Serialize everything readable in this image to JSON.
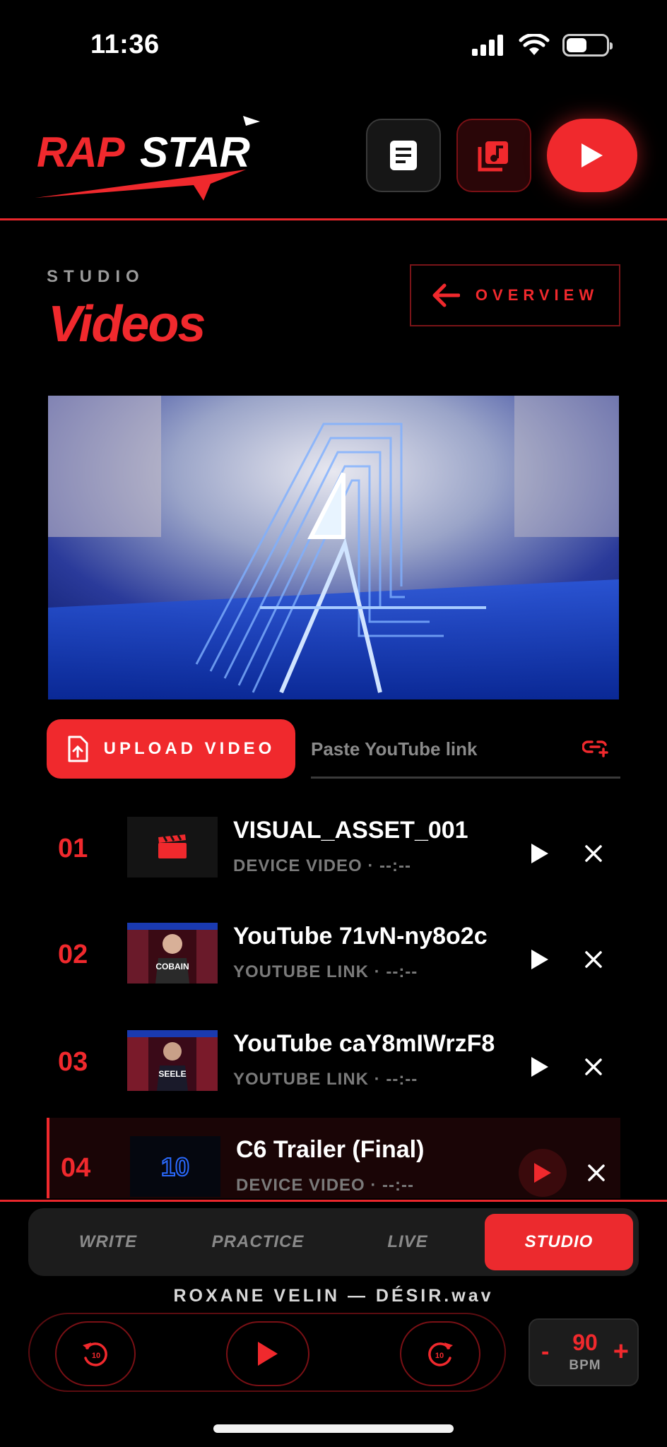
{
  "status_bar": {
    "time": "11:36"
  },
  "brand": {
    "name": "RAPSTAR",
    "accent": "#f0292d"
  },
  "header": {
    "notes_icon": "notes-icon",
    "music_icon": "music-library-icon",
    "play_icon": "play-icon"
  },
  "page": {
    "eyebrow": "STUDIO",
    "title": "Videos",
    "overview_label": "OVERVIEW"
  },
  "player": {
    "graphic_text": "4"
  },
  "upload": {
    "button_label": "UPLOAD VIDEO",
    "youtube_placeholder": "Paste YouTube link",
    "youtube_value": ""
  },
  "videos": [
    {
      "num": "01",
      "title": "VISUAL_ASSET_001",
      "meta": "DEVICE VIDEO · --:--",
      "thumb": "clapperboard-icon",
      "thumb_text": "",
      "active": false
    },
    {
      "num": "02",
      "title": "YouTube 71vN-ny8o2c",
      "meta": "YOUTUBE LINK · --:--",
      "thumb": "youtube-thumbnail",
      "thumb_text": "COBAIN",
      "active": false
    },
    {
      "num": "03",
      "title": "YouTube caY8mIWrzF8",
      "meta": "YOUTUBE LINK · --:--",
      "thumb": "youtube-thumbnail",
      "thumb_text": "SEELE",
      "active": false
    },
    {
      "num": "04",
      "title": "C6 Trailer (Final)",
      "meta": "DEVICE VIDEO · --:--",
      "thumb": "video-thumbnail",
      "thumb_text": "10",
      "active": true
    }
  ],
  "tabs": [
    {
      "label": "WRITE",
      "active": false
    },
    {
      "label": "PRACTICE",
      "active": false
    },
    {
      "label": "LIVE",
      "active": false
    },
    {
      "label": "STUDIO",
      "active": true
    }
  ],
  "now_playing": "ROXANE VELIN — DÉSIR.wav",
  "transport": {
    "skip_back": "10",
    "skip_forward": "10"
  },
  "bpm": {
    "minus": "-",
    "value": "90",
    "unit": "BPM",
    "plus": "+"
  }
}
